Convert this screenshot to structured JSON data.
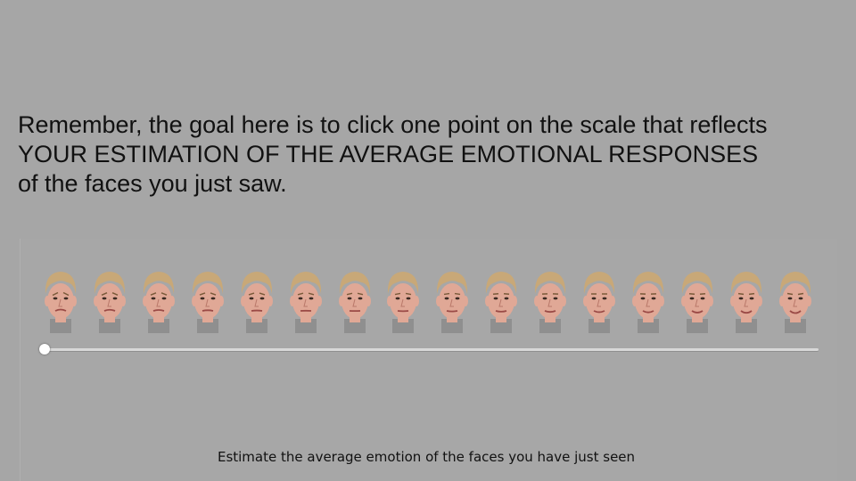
{
  "instructions": {
    "line1": "Remember, the goal here is to click one point on the scale that reflects",
    "line2": "YOUR ESTIMATION OF THE AVERAGE EMOTIONAL RESPONSES",
    "line3": "of the faces you just saw."
  },
  "scale": {
    "face_count": 16,
    "faces_icon": "face-photo-icon",
    "expression_from": "sad",
    "expression_to": "happy",
    "slider_value_fraction": 0.0
  },
  "caption": "Estimate the average emotion of the faces you have just seen",
  "colors": {
    "background": "#a6a6a6",
    "text": "#111111",
    "track": "#d8d8d8",
    "thumb": "#ffffff",
    "hair": "#c8a878",
    "skin": "#e0a896"
  }
}
